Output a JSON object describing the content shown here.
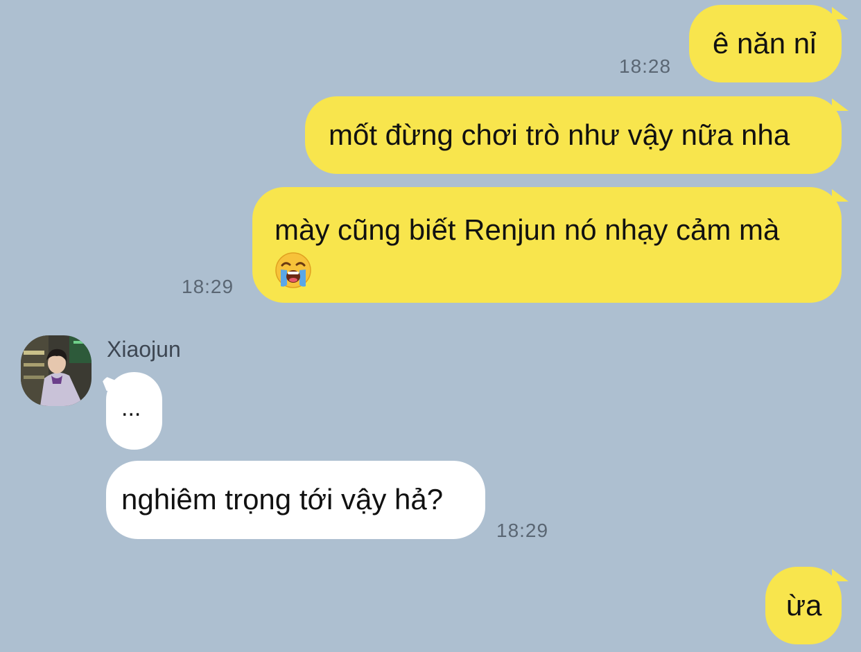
{
  "messages": [
    {
      "text": "ê năn nỉ",
      "time": "18:28"
    },
    {
      "text": "mốt đừng chơi trò như vậy nữa nha"
    },
    {
      "text": "mày cũng biết Renjun nó nhạy cảm mà",
      "emoji": "loudly-crying-face-icon",
      "time": "18:29"
    },
    {
      "sender": "Xiaojun",
      "text": "..."
    },
    {
      "text": "nghiêm trọng tới vậy hả?",
      "time": "18:29"
    },
    {
      "text": "ừa"
    }
  ],
  "colors": {
    "background": "#adbfd0",
    "outgoing_bubble": "#f8e54d",
    "incoming_bubble": "#ffffff"
  }
}
